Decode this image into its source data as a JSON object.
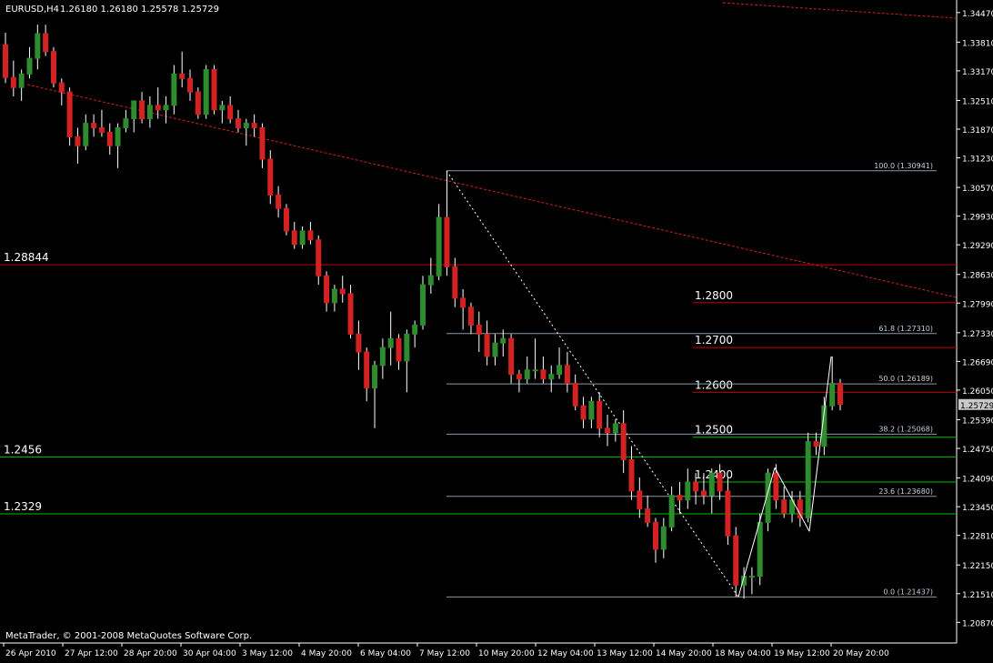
{
  "header": {
    "symbol": "EURUSD,H4",
    "ohlc": "1.26180 1.26180 1.25578 1.25729"
  },
  "copyright": "MetaTrader, © 2001-2008 MetaQuotes Software Corp.",
  "colors": {
    "background": "#000000",
    "bull": "#2e8b2e",
    "bear": "#d42222",
    "wick": "#ffffff",
    "support_green": "#00c000",
    "resistance_red": "#c00000",
    "trendline": "#cc2222",
    "fib": "#8a9aa6",
    "axis_text": "#ffffff",
    "price_tag_bg": "#c8c8c8"
  },
  "chart_data": {
    "type": "candlestick",
    "title": "EURUSD,H4",
    "ylim": [
      1.2041,
      1.3475
    ],
    "y_ticks": [
      "1.34470",
      "1.33810",
      "1.33170",
      "1.32510",
      "1.31870",
      "1.31230",
      "1.30570",
      "1.29930",
      "1.29290",
      "1.28630",
      "1.27990",
      "1.27330",
      "1.26690",
      "1.26050",
      "1.25390",
      "1.24750",
      "1.24090",
      "1.23450",
      "1.22810",
      "1.22150",
      "1.21510",
      "1.20870"
    ],
    "current_price": "1.25729",
    "x_labels": [
      "26 Apr 2010",
      "27 Apr 12:00",
      "28 Apr 20:00",
      "30 Apr 04:00",
      "3 May 12:00",
      "4 May 20:00",
      "6 May 04:00",
      "7 May 12:00",
      "10 May 20:00",
      "12 May 04:00",
      "13 May 12:00",
      "14 May 20:00",
      "18 May 04:00",
      "19 May 12:00",
      "20 May 20:00"
    ],
    "horizontal_levels": [
      {
        "label": "1.28844",
        "price": 1.28844,
        "type": "resistance"
      },
      {
        "label": "1.2456",
        "price": 1.2456,
        "type": "support"
      },
      {
        "label": "1.2329",
        "price": 1.2329,
        "type": "support"
      },
      {
        "label": "1.2800",
        "price": 1.28,
        "type": "resistance"
      },
      {
        "label": "1.2700",
        "price": 1.27,
        "type": "resistance"
      },
      {
        "label": "1.2600",
        "price": 1.26,
        "type": "resistance"
      },
      {
        "label": "1.2500",
        "price": 1.25,
        "type": "support"
      },
      {
        "label": "1.2400",
        "price": 1.24,
        "type": "support"
      }
    ],
    "fibonacci": [
      {
        "label": "100.0 (1.30941)",
        "price": 1.30941
      },
      {
        "label": "61.8 (1.27310)",
        "price": 1.2731
      },
      {
        "label": "50.0 (1.26189)",
        "price": 1.26189
      },
      {
        "label": "38.2 (1.25068)",
        "price": 1.25068
      },
      {
        "label": "23.6 (1.23680)",
        "price": 1.2368
      },
      {
        "label": "0.0 (1.21437)",
        "price": 1.21437
      }
    ],
    "candles": [
      [
        1.3375,
        1.3402,
        1.329,
        1.3302
      ],
      [
        1.3302,
        1.334,
        1.326,
        1.328
      ],
      [
        1.328,
        1.332,
        1.325,
        1.331
      ],
      [
        1.331,
        1.337,
        1.33,
        1.3345
      ],
      [
        1.3345,
        1.342,
        1.332,
        1.34
      ],
      [
        1.34,
        1.342,
        1.335,
        1.336
      ],
      [
        1.336,
        1.337,
        1.328,
        1.329
      ],
      [
        1.329,
        1.33,
        1.324,
        1.327
      ],
      [
        1.327,
        1.328,
        1.315,
        1.317
      ],
      [
        1.317,
        1.319,
        1.311,
        1.315
      ],
      [
        1.315,
        1.322,
        1.314,
        1.32
      ],
      [
        1.32,
        1.322,
        1.317,
        1.319
      ],
      [
        1.319,
        1.323,
        1.317,
        1.318
      ],
      [
        1.318,
        1.32,
        1.313,
        1.315
      ],
      [
        1.315,
        1.32,
        1.31,
        1.319
      ],
      [
        1.319,
        1.323,
        1.318,
        1.321
      ],
      [
        1.321,
        1.325,
        1.318,
        1.325
      ],
      [
        1.325,
        1.327,
        1.32,
        1.321
      ],
      [
        1.321,
        1.326,
        1.319,
        1.324
      ],
      [
        1.324,
        1.328,
        1.321,
        1.323
      ],
      [
        1.323,
        1.326,
        1.32,
        1.324
      ],
      [
        1.324,
        1.333,
        1.322,
        1.331
      ],
      [
        1.331,
        1.336,
        1.328,
        1.33
      ],
      [
        1.33,
        1.332,
        1.325,
        1.327
      ],
      [
        1.327,
        1.328,
        1.321,
        1.322
      ],
      [
        1.322,
        1.333,
        1.321,
        1.332
      ],
      [
        1.332,
        1.333,
        1.322,
        1.323
      ],
      [
        1.323,
        1.325,
        1.32,
        1.324
      ],
      [
        1.324,
        1.326,
        1.32,
        1.321
      ],
      [
        1.321,
        1.323,
        1.318,
        1.319
      ],
      [
        1.319,
        1.321,
        1.315,
        1.32
      ],
      [
        1.32,
        1.322,
        1.317,
        1.319
      ],
      [
        1.319,
        1.32,
        1.31,
        1.312
      ],
      [
        1.312,
        1.314,
        1.302,
        1.304
      ],
      [
        1.304,
        1.306,
        1.299,
        1.301
      ],
      [
        1.301,
        1.302,
        1.295,
        1.296
      ],
      [
        1.296,
        1.298,
        1.292,
        1.293
      ],
      [
        1.293,
        1.297,
        1.292,
        1.296
      ],
      [
        1.296,
        1.298,
        1.293,
        1.294
      ],
      [
        1.294,
        1.295,
        1.284,
        1.286
      ],
      [
        1.286,
        1.287,
        1.278,
        1.28
      ],
      [
        1.28,
        1.284,
        1.278,
        1.283
      ],
      [
        1.283,
        1.286,
        1.28,
        1.282
      ],
      [
        1.282,
        1.284,
        1.272,
        1.273
      ],
      [
        1.273,
        1.276,
        1.265,
        1.269
      ],
      [
        1.269,
        1.27,
        1.258,
        1.261
      ],
      [
        1.261,
        1.267,
        1.252,
        1.266
      ],
      [
        1.266,
        1.272,
        1.263,
        1.27
      ],
      [
        1.27,
        1.278,
        1.266,
        1.272
      ],
      [
        1.272,
        1.273,
        1.265,
        1.267
      ],
      [
        1.267,
        1.274,
        1.26,
        1.273
      ],
      [
        1.273,
        1.276,
        1.27,
        1.275
      ],
      [
        1.275,
        1.286,
        1.274,
        1.284
      ],
      [
        1.284,
        1.29,
        1.282,
        1.286
      ],
      [
        1.286,
        1.302,
        1.285,
        1.299
      ],
      [
        1.299,
        1.3094,
        1.286,
        1.288
      ],
      [
        1.288,
        1.29,
        1.279,
        1.281
      ],
      [
        1.281,
        1.283,
        1.274,
        1.279
      ],
      [
        1.279,
        1.28,
        1.273,
        1.275
      ],
      [
        1.275,
        1.278,
        1.269,
        1.273
      ],
      [
        1.273,
        1.276,
        1.266,
        1.268
      ],
      [
        1.268,
        1.273,
        1.266,
        1.271
      ],
      [
        1.271,
        1.274,
        1.268,
        1.272
      ],
      [
        1.272,
        1.273,
        1.262,
        1.264
      ],
      [
        1.264,
        1.265,
        1.26,
        1.263
      ],
      [
        1.263,
        1.268,
        1.262,
        1.265
      ],
      [
        1.265,
        1.272,
        1.263,
        1.265
      ],
      [
        1.265,
        1.268,
        1.262,
        1.263
      ],
      [
        1.263,
        1.266,
        1.26,
        1.264
      ],
      [
        1.264,
        1.27,
        1.263,
        1.266
      ],
      [
        1.266,
        1.269,
        1.26,
        1.262
      ],
      [
        1.262,
        1.264,
        1.256,
        1.257
      ],
      [
        1.257,
        1.259,
        1.252,
        1.254
      ],
      [
        1.254,
        1.259,
        1.252,
        1.258
      ],
      [
        1.258,
        1.26,
        1.25,
        1.252
      ],
      [
        1.252,
        1.255,
        1.248,
        1.251
      ],
      [
        1.251,
        1.254,
        1.249,
        1.253
      ],
      [
        1.253,
        1.256,
        1.242,
        1.245
      ],
      [
        1.245,
        1.248,
        1.236,
        1.238
      ],
      [
        1.238,
        1.241,
        1.232,
        1.234
      ],
      [
        1.234,
        1.237,
        1.23,
        1.231
      ],
      [
        1.231,
        1.232,
        1.222,
        1.225
      ],
      [
        1.225,
        1.232,
        1.223,
        1.23
      ],
      [
        1.23,
        1.239,
        1.229,
        1.237
      ],
      [
        1.237,
        1.24,
        1.233,
        1.236
      ],
      [
        1.236,
        1.243,
        1.234,
        1.24
      ],
      [
        1.24,
        1.242,
        1.235,
        1.238
      ],
      [
        1.238,
        1.242,
        1.235,
        1.237
      ],
      [
        1.237,
        1.243,
        1.233,
        1.242
      ],
      [
        1.242,
        1.244,
        1.236,
        1.238
      ],
      [
        1.238,
        1.241,
        1.226,
        1.228
      ],
      [
        1.228,
        1.23,
        1.2144,
        1.217
      ],
      [
        1.217,
        1.221,
        1.214,
        1.219
      ],
      [
        1.219,
        1.221,
        1.215,
        1.219
      ],
      [
        1.219,
        1.233,
        1.217,
        1.231
      ],
      [
        1.231,
        1.243,
        1.229,
        1.242
      ],
      [
        1.242,
        1.244,
        1.234,
        1.236
      ],
      [
        1.236,
        1.239,
        1.232,
        1.233
      ],
      [
        1.233,
        1.238,
        1.231,
        1.236
      ],
      [
        1.236,
        1.238,
        1.23,
        1.232
      ],
      [
        1.232,
        1.251,
        1.231,
        1.249
      ],
      [
        1.249,
        1.251,
        1.246,
        1.248
      ],
      [
        1.248,
        1.259,
        1.246,
        1.257
      ],
      [
        1.257,
        1.268,
        1.256,
        1.262
      ],
      [
        1.262,
        1.263,
        1.256,
        1.2573
      ]
    ]
  }
}
